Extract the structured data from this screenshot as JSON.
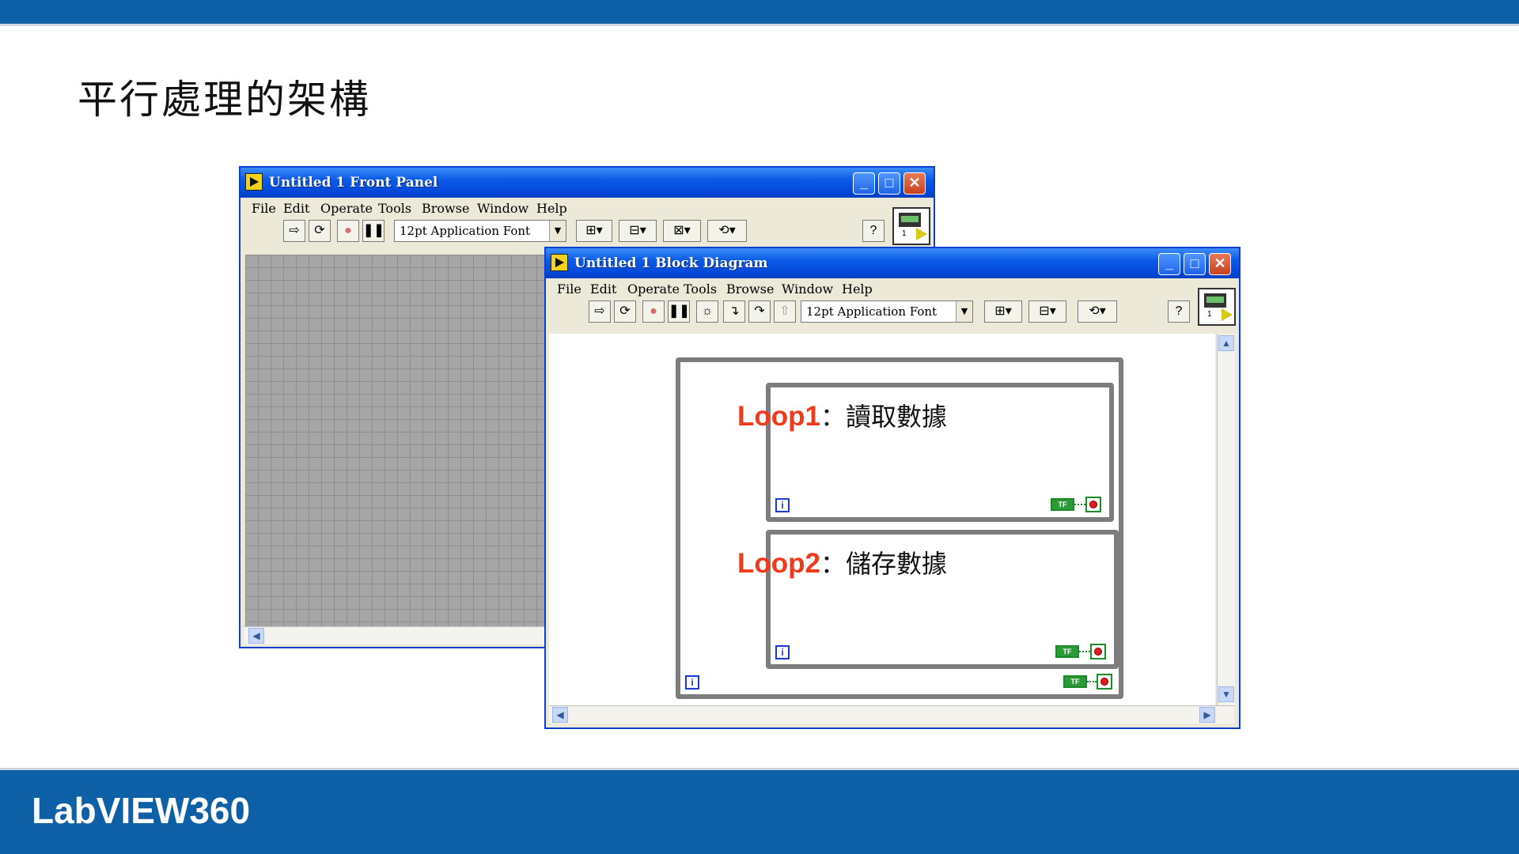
{
  "slide": {
    "title": "平行處理的架構",
    "brand": "LabVIEW360"
  },
  "front_panel": {
    "title": "Untitled 1 Front Panel",
    "menu": [
      "File",
      "Edit",
      "Operate",
      "Tools",
      "Browse",
      "Window",
      "Help"
    ],
    "font_selector": "12pt Application Font"
  },
  "block_diagram": {
    "title": "Untitled 1 Block Diagram",
    "menu": [
      "File",
      "Edit",
      "Operate",
      "Tools",
      "Browse",
      "Window",
      "Help"
    ],
    "font_selector": "12pt Application Font",
    "loops": [
      {
        "name": "Loop1",
        "desc": "：讀取數據"
      },
      {
        "name": "Loop2",
        "desc": "：儲存數據"
      }
    ],
    "iteration_label": "i",
    "tf_label": "TF"
  },
  "vi_icon_number": "1",
  "colors": {
    "slide_bar": "#0d5fa6",
    "xp_title": "#0a5be6",
    "loop_label": "#ef3a1b",
    "while_loop_border": "#7d7d7d"
  },
  "icons": [
    "run-arrow-icon",
    "run-continuous-icon",
    "abort-icon",
    "pause-icon",
    "highlight-execution-icon",
    "step-into-icon",
    "step-over-icon",
    "step-out-icon",
    "align-icon",
    "distribute-icon",
    "resize-icon",
    "reorder-icon",
    "help-icon",
    "vi-icon",
    "minimize-icon",
    "maximize-icon",
    "close-icon"
  ]
}
